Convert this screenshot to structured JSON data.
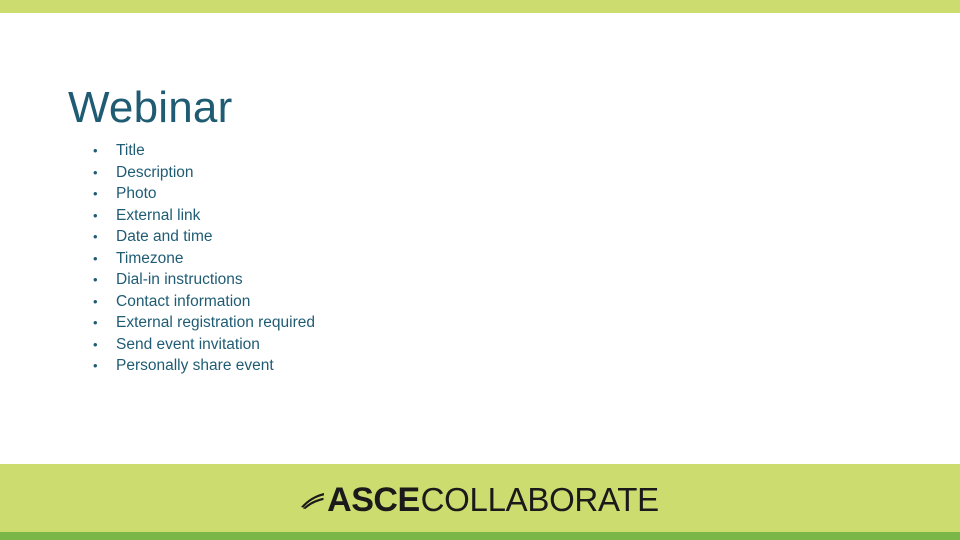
{
  "slide": {
    "title": "Webinar",
    "bullet_marker": "•",
    "bullets": [
      "Title",
      "Description",
      "Photo",
      "External link",
      "Date and time",
      "Timezone",
      "Dial-in instructions",
      "Contact information",
      "External registration required",
      "Send event invitation",
      "Personally share event"
    ]
  },
  "footer": {
    "logo_primary": "ASCE",
    "logo_secondary": "COLLABORATE"
  },
  "colors": {
    "band": "#cddc6f",
    "rule": "#7ab648",
    "text": "#1f5c74",
    "logo": "#1a1a1a"
  }
}
